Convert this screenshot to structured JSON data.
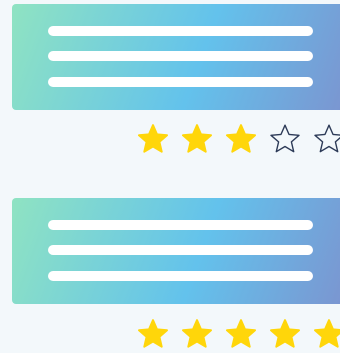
{
  "colors": {
    "gradient_start": "#8fe3c2",
    "gradient_mid": "#63c2ec",
    "gradient_end": "#7c93cf",
    "star_filled": "#ffd60a",
    "star_empty_stroke": "#2c3a57"
  },
  "reviews": [
    {
      "rating": 3,
      "max_rating": 5,
      "text_lines": 3
    },
    {
      "rating": 5,
      "max_rating": 5,
      "text_lines": 3
    }
  ]
}
